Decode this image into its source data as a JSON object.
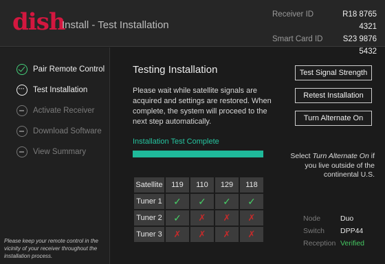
{
  "header": {
    "logo": "dish",
    "title": "Install - Test Installation",
    "receiver_label": "Receiver ID",
    "receiver_value": "R18 8765 4321",
    "smartcard_label": "Smart Card ID",
    "smartcard_value": "S23 9876 5432"
  },
  "sidebar": {
    "steps": [
      {
        "label": "Pair Remote Control",
        "state": "done"
      },
      {
        "label": "Test Installation",
        "state": "current"
      },
      {
        "label": "Activate Receiver",
        "state": "pending"
      },
      {
        "label": "Download Software",
        "state": "pending"
      },
      {
        "label": "View Summary",
        "state": "pending"
      }
    ],
    "help_note": "Please keep your remote control in the vicinity of your receiver throughout the installation process."
  },
  "main": {
    "title": "Testing Installation",
    "description": "Please wait while satellite signals are acquired and settings are restored.  When complete, the system will proceed to the next step automatically.",
    "status_label": "Installation Test Complete",
    "progress": 1.0,
    "accent_color": "#1fb99a"
  },
  "actions": {
    "test_signal": "Test Signal Strength",
    "retest": "Retest Installation",
    "alternate": "Turn Alternate On",
    "note_prefix": "Select ",
    "note_em": "Turn Alternate On",
    "note_suffix": " if you live outside of the continental U.S."
  },
  "signal_table": {
    "header_label": "Satellite",
    "satellites": [
      "119",
      "110",
      "129",
      "118"
    ],
    "rows": [
      {
        "tuner": "Tuner 1",
        "results": [
          "ok",
          "ok",
          "ok",
          "ok"
        ]
      },
      {
        "tuner": "Tuner 2",
        "results": [
          "ok",
          "bad",
          "bad",
          "bad"
        ]
      },
      {
        "tuner": "Tuner 3",
        "results": [
          "bad",
          "bad",
          "bad",
          "bad"
        ]
      }
    ]
  },
  "status": {
    "node_label": "Node",
    "node_value": "Duo",
    "switch_label": "Switch",
    "switch_value": "DPP44",
    "reception_label": "Reception",
    "reception_value": "Verified"
  }
}
